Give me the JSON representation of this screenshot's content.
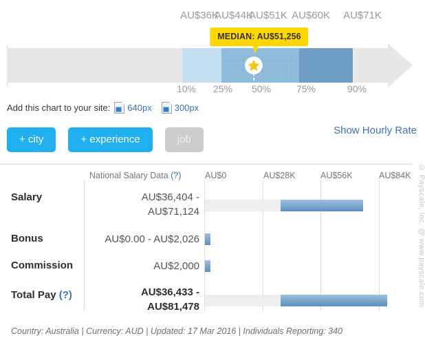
{
  "range_chart": {
    "top_labels": [
      {
        "text": "AU$36K",
        "pos_pct": 10
      },
      {
        "text": "AU$44K",
        "pos_pct": 25
      },
      {
        "text": "AU$51K",
        "pos_pct": 50
      },
      {
        "text": "AU$60K",
        "pos_pct": 75
      },
      {
        "text": "AU$71K",
        "pos_pct": 90
      }
    ],
    "bottom_labels": [
      {
        "text": "10%",
        "pos_pct": 10
      },
      {
        "text": "25%",
        "pos_pct": 25
      },
      {
        "text": "50%",
        "pos_pct": 50
      },
      {
        "text": "75%",
        "pos_pct": 75
      },
      {
        "text": "90%",
        "pos_pct": 90
      }
    ],
    "median_tooltip": "MEDIAN: AU$51,256",
    "colors": {
      "track": "#e7e7e7",
      "seg_10_25": "#c3dff0",
      "seg_25_75": "#8fbcdb",
      "seg_75_90": "#6f9dc4",
      "tooltip": "#ffd700",
      "star": "#f5c518"
    }
  },
  "embed": {
    "label": "Add this chart to your site:",
    "options": [
      {
        "label": "640px",
        "icon": "embed-code-icon"
      },
      {
        "label": "300px",
        "icon": "embed-code-icon"
      }
    ]
  },
  "buttons": {
    "city": "+ city",
    "experience": "+ experience",
    "job": "job",
    "hourly_rate": "Show Hourly Rate"
  },
  "table": {
    "national_header": "National Salary Data",
    "national_header_help": "(?)",
    "axis_labels": [
      "AU$0",
      "AU$28K",
      "AU$56K",
      "AU$84K"
    ],
    "rows": [
      {
        "label": "Salary",
        "help": "",
        "value": "AU$36,404 - AU$71,124",
        "value_line1": "AU$36,404 -",
        "value_line2": "AU$71,124",
        "bold": false,
        "bar_start": 36404,
        "bar_end": 71124
      },
      {
        "label": "Bonus",
        "help": "",
        "value": "AU$0.00 - AU$2,026",
        "value_line1": "AU$0.00 - AU$2,026",
        "value_line2": "",
        "bold": false,
        "bar_start": 0,
        "bar_end": 2026
      },
      {
        "label": "Commission",
        "help": "",
        "value": "AU$2,000",
        "value_line1": "AU$2,000",
        "value_line2": "",
        "bold": false,
        "bar_start": 0,
        "bar_end": 2000
      },
      {
        "label": "Total Pay",
        "help": "(?)",
        "value": "AU$36,433 - AU$81,478",
        "value_line1": "AU$36,433 -",
        "value_line2": "AU$81,478",
        "bold": true,
        "bar_start": 36433,
        "bar_end": 81478
      }
    ]
  },
  "footer": "Country: Australia | Currency: AUD | Updated: 17 Mar 2016 | Individuals Reporting: 340",
  "watermark": "© Payscale, Inc. @ www.payscale.com",
  "chart_data": {
    "type": "bar",
    "title": "National Salary Data",
    "xlabel": "",
    "ylabel": "",
    "axis_ticks": [
      0,
      28000,
      56000,
      84000
    ],
    "axis_tick_labels": [
      "AU$0",
      "AU$28K",
      "AU$56K",
      "AU$84K"
    ],
    "xlim": [
      0,
      84000
    ],
    "categories": [
      "Salary",
      "Bonus",
      "Commission",
      "Total Pay"
    ],
    "series": [
      {
        "name": "range_low",
        "values": [
          36404,
          0,
          0,
          36433
        ]
      },
      {
        "name": "range_high",
        "values": [
          71124,
          2026,
          2000,
          81478
        ]
      }
    ],
    "percentile_chart": {
      "type": "range",
      "percentiles": [
        10,
        25,
        50,
        75,
        90
      ],
      "values": [
        36000,
        44000,
        51000,
        60000,
        71000
      ],
      "value_labels": [
        "AU$36K",
        "AU$44K",
        "AU$51K",
        "AU$60K",
        "AU$71K"
      ],
      "median": 51256,
      "median_label": "MEDIAN: AU$51,256"
    },
    "grid": true,
    "legend": "none"
  }
}
